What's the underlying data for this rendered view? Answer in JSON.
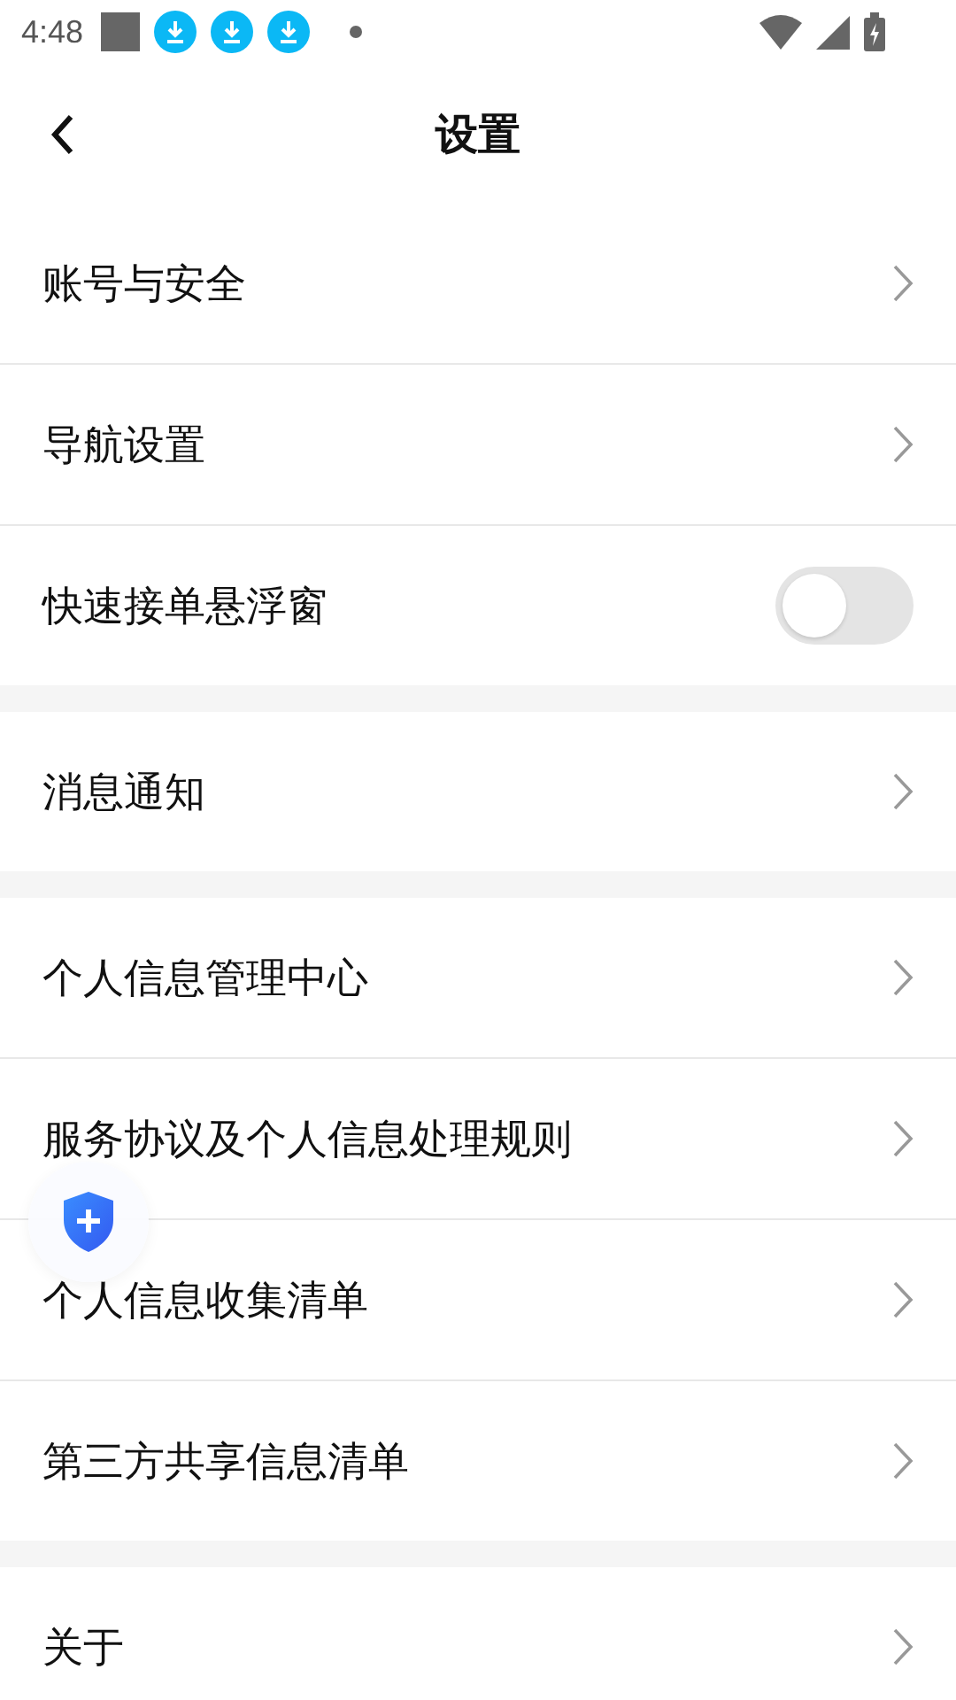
{
  "status_bar": {
    "time": "4:48"
  },
  "header": {
    "title": "设置"
  },
  "sections": [
    {
      "items": [
        {
          "kind": "link",
          "label": "账号与安全"
        },
        {
          "kind": "link",
          "label": "导航设置"
        },
        {
          "kind": "toggle",
          "label": "快速接单悬浮窗",
          "on": false
        }
      ]
    },
    {
      "items": [
        {
          "kind": "link",
          "label": "消息通知"
        }
      ]
    },
    {
      "items": [
        {
          "kind": "link",
          "label": "个人信息管理中心"
        },
        {
          "kind": "link",
          "label": "服务协议及个人信息处理规则"
        },
        {
          "kind": "link",
          "label": "个人信息收集清单"
        },
        {
          "kind": "link",
          "label": "第三方共享信息清单"
        }
      ]
    },
    {
      "items": [
        {
          "kind": "link",
          "label": "关于"
        }
      ]
    }
  ]
}
